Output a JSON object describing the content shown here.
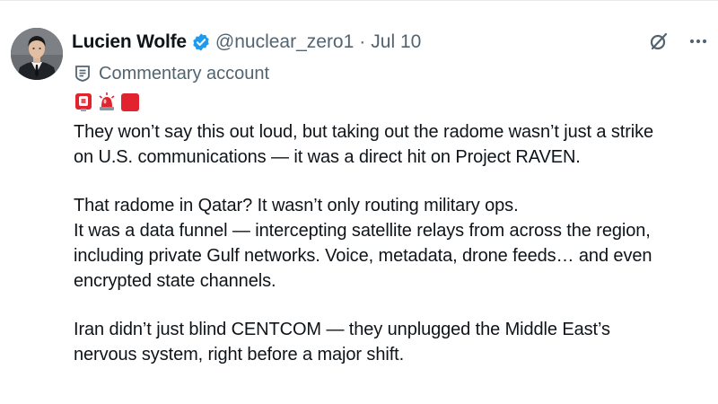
{
  "tweet": {
    "author": {
      "display_name": "Lucien Wolfe",
      "handle": "@nuclear_zero1",
      "separator": "·",
      "date": "Jul 10",
      "verified_color": "#1d9bf0"
    },
    "label": {
      "text": "Commentary account",
      "icon": "label-tag-icon"
    },
    "emojis": [
      "red-button-emoji",
      "police-light-emoji",
      "red-square-emoji"
    ],
    "paragraphs": [
      {
        "lines": [
          "They won’t say this out loud, but taking out the radome wasn’t just a strike",
          "on U.S. communications — it was a direct hit on Project RAVEN."
        ]
      },
      {
        "lines": [
          "That radome in Qatar? It wasn’t only routing military ops.",
          "It was a data funnel — intercepting satellite relays from across the region,",
          "including private Gulf networks. Voice, metadata, drone feeds… and even",
          "encrypted state channels."
        ]
      },
      {
        "lines": [
          "Iran didn’t just blind CENTCOM — they unplugged the Middle East’s",
          "nervous system, right before a major shift."
        ]
      }
    ]
  },
  "actions": {
    "grok_icon": "grok-icon",
    "more_icon": "more-options-icon"
  },
  "colors": {
    "text": "#0f1419",
    "muted": "#536471",
    "accent": "#1d9bf0",
    "emoji_red": "#e0232e"
  }
}
